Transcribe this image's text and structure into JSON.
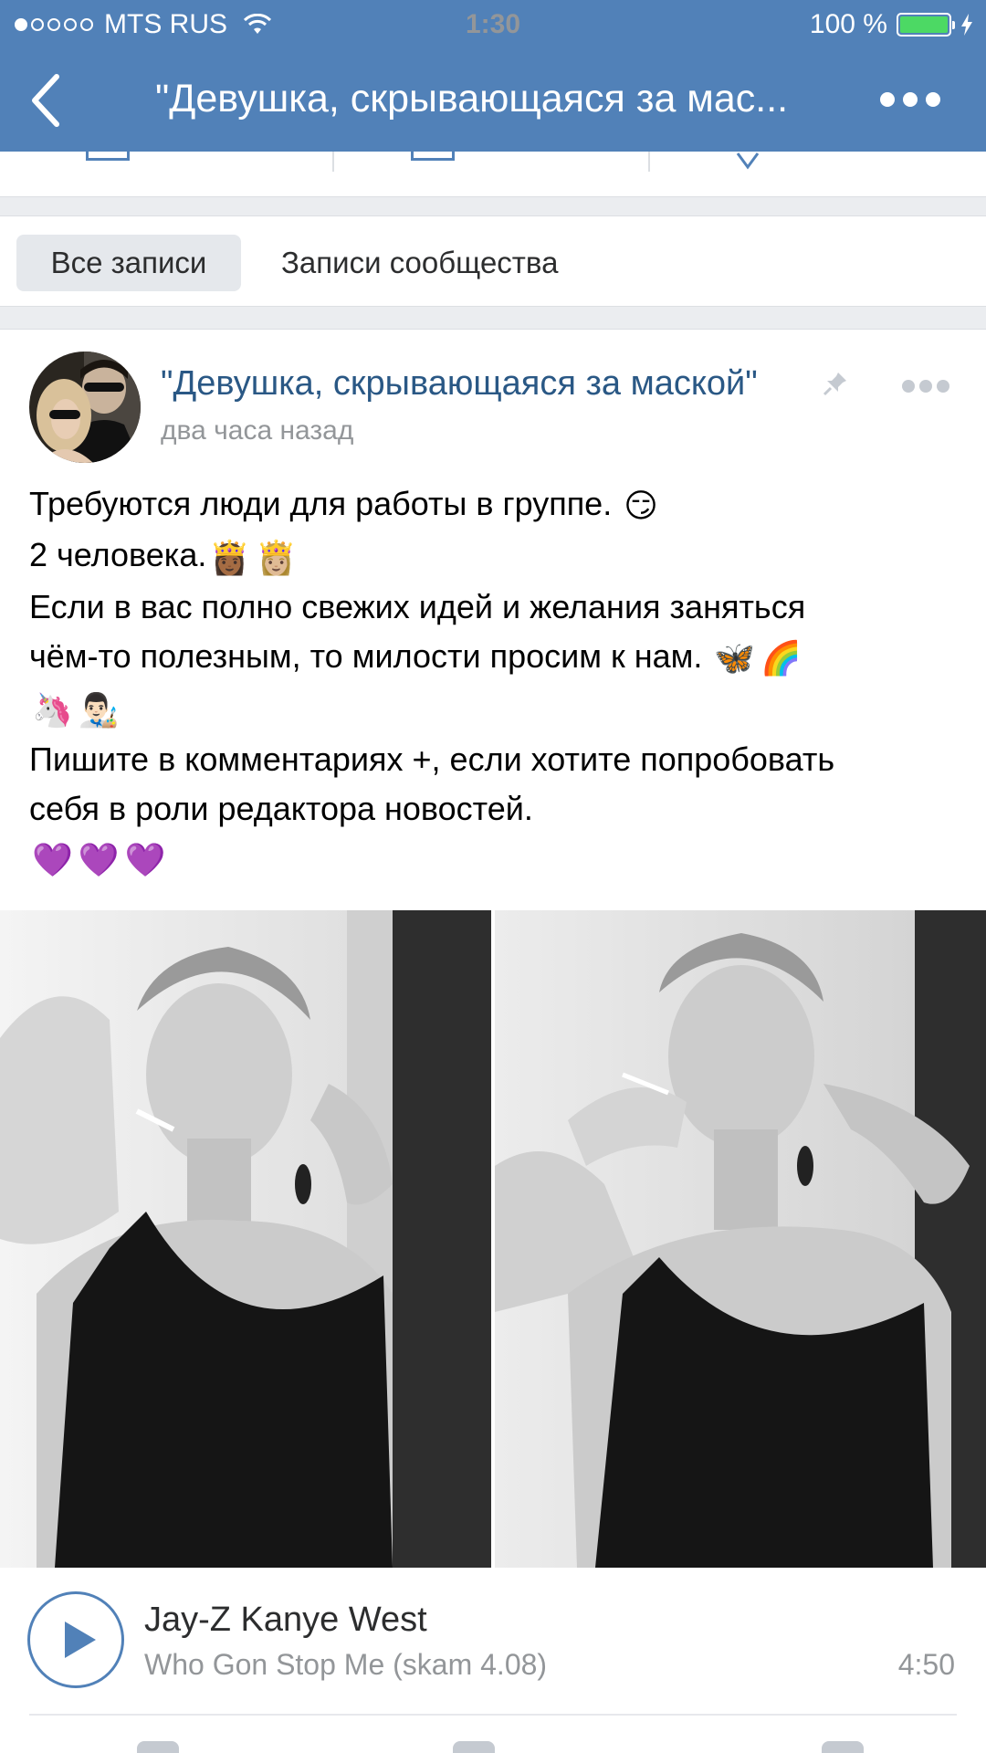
{
  "status_bar": {
    "carrier": "MTS RUS",
    "time": "1:30",
    "battery": "100 %",
    "battery_level": 1.0,
    "signal_filled_dots": 1,
    "signal_total_dots": 5
  },
  "nav": {
    "title": "\"Девушка, скрывающаяся за мас...",
    "back_icon": "chevron-left-icon",
    "more_icon": "more-horizontal-icon"
  },
  "filters": {
    "all": "Все записи",
    "community": "Записи сообщества"
  },
  "post": {
    "author": "\"Девушка, скрывающаяся за маской\"",
    "time": "два часа назад",
    "lines": {
      "l1": "Требуются люди для работы в группе.",
      "l2": "2 человека.",
      "l3": "Если в вас полно свежих идей и желания заняться",
      "l4": "чём-то полезным, то милости просим к нам.",
      "l6": "Пишите в комментариях +, если хотите попробовать",
      "l7": "себя в роли редактора новостей."
    },
    "emoji": {
      "smirk": "😏",
      "princess_1": "👸🏾",
      "princess_2": "👸🏼",
      "butterfly": "🦋",
      "rainbow": "🌈",
      "unicorn": "🦄",
      "artist": "👨🏻‍🎨",
      "heart": "💜"
    }
  },
  "audio": {
    "artist": "Jay-Z  Kanye West",
    "title": "Who Gon Stop Me (skam 4.08)",
    "duration": "4:50"
  },
  "colors": {
    "header": "#5181b8",
    "link": "#2a5885",
    "muted": "#939699",
    "battery": "#4cd964",
    "background": "#ebedf0"
  }
}
